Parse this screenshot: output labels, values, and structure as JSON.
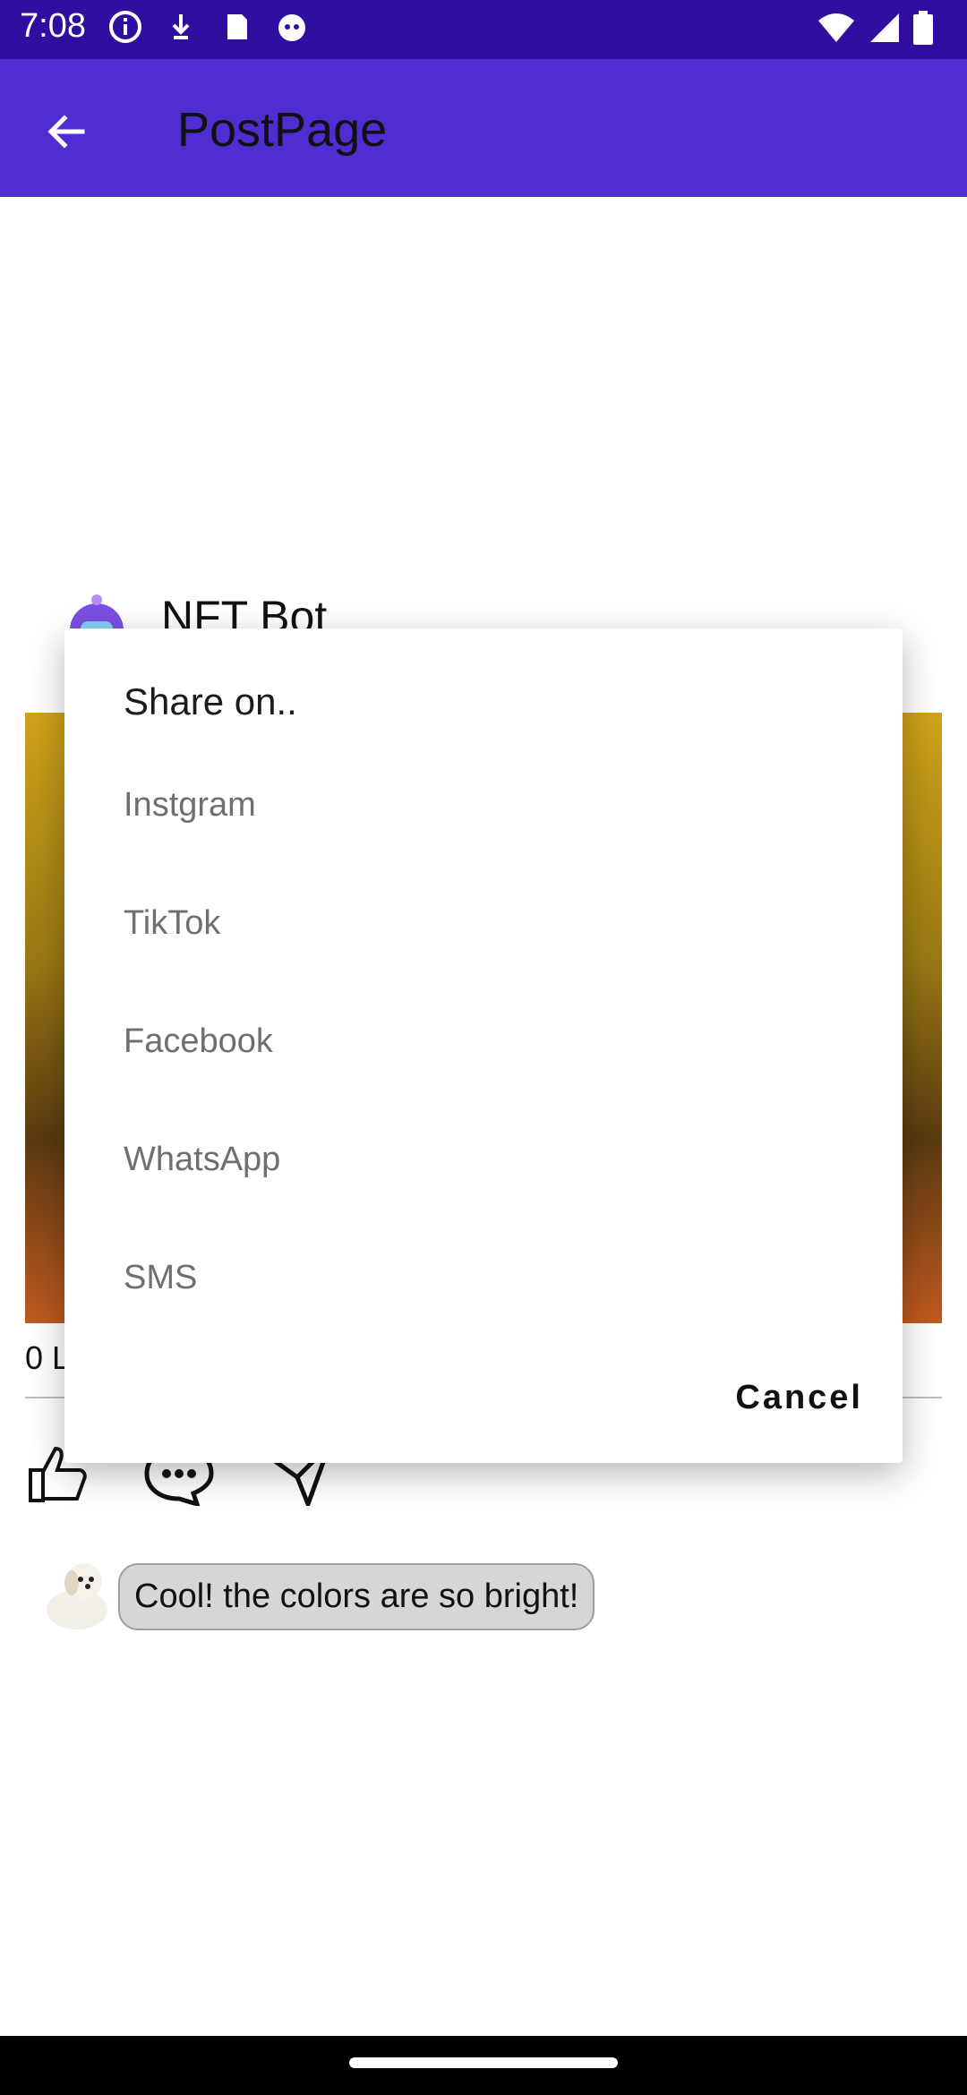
{
  "status_bar": {
    "time": "7:08"
  },
  "app_bar": {
    "title": "PostPage"
  },
  "post": {
    "author": "NFT Bot",
    "likes_text": "0 L"
  },
  "comment": {
    "text": "Cool! the colors are so bright!"
  },
  "dialog": {
    "title": "Share on..",
    "options": [
      "Instgram",
      "TikTok",
      "Facebook",
      "WhatsApp",
      "SMS"
    ],
    "cancel_label": "Cancel"
  },
  "colors": {
    "status_bar": "#2f0ea0",
    "app_bar": "#4f2dd0",
    "dialog_bg": "#ffffff",
    "option_text": "#6f6f6f"
  }
}
